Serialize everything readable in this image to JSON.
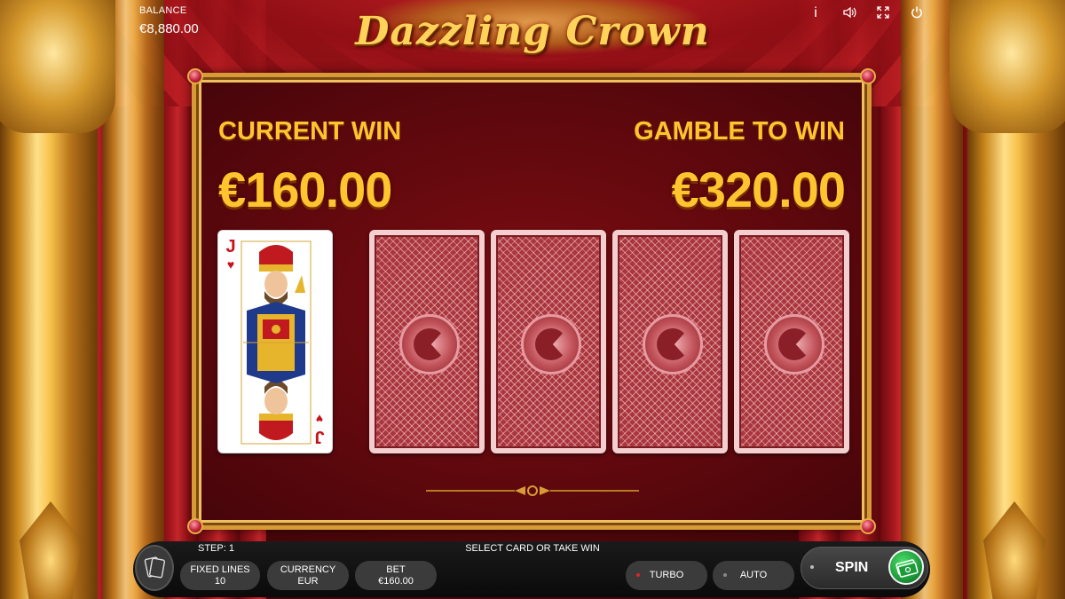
{
  "game": {
    "logo_text": "Dazzling Crown"
  },
  "hud": {
    "balance_label": "BALANCE",
    "balance_value": "€8,880.00",
    "icons": [
      "info-icon",
      "sound-icon",
      "fullscreen-icon",
      "power-icon"
    ],
    "icon_glyphs": [
      "i",
      "🔊",
      "⤢",
      "⏻"
    ]
  },
  "gamble": {
    "current_win_label": "CURRENT WIN",
    "current_win_value": "€160.00",
    "gamble_to_win_label": "GAMBLE TO WIN",
    "gamble_to_win_value": "€320.00",
    "dealer_card": {
      "rank": "J",
      "suit": "♥",
      "suit_name": "hearts"
    },
    "face_down_cards": 4
  },
  "bottom_bar": {
    "step": "STEP: 1",
    "status_message": "SELECT CARD OR TAKE WIN",
    "fixed_lines_label": "FIXED LINES",
    "fixed_lines_value": "10",
    "currency_label": "CURRENCY",
    "currency_value": "EUR",
    "bet_label": "BET",
    "bet_value": "€160.00",
    "turbo_label": "TURBO",
    "auto_label": "AUTO",
    "spin_label": "SPIN"
  },
  "colors": {
    "win_gold": "#ffc42e",
    "board_red": "#5d080d",
    "frame_gold": "#d79a37",
    "card_back": "#a9363e",
    "spin_green": "#1c9b39",
    "turbo_dot": "#e0232b"
  }
}
